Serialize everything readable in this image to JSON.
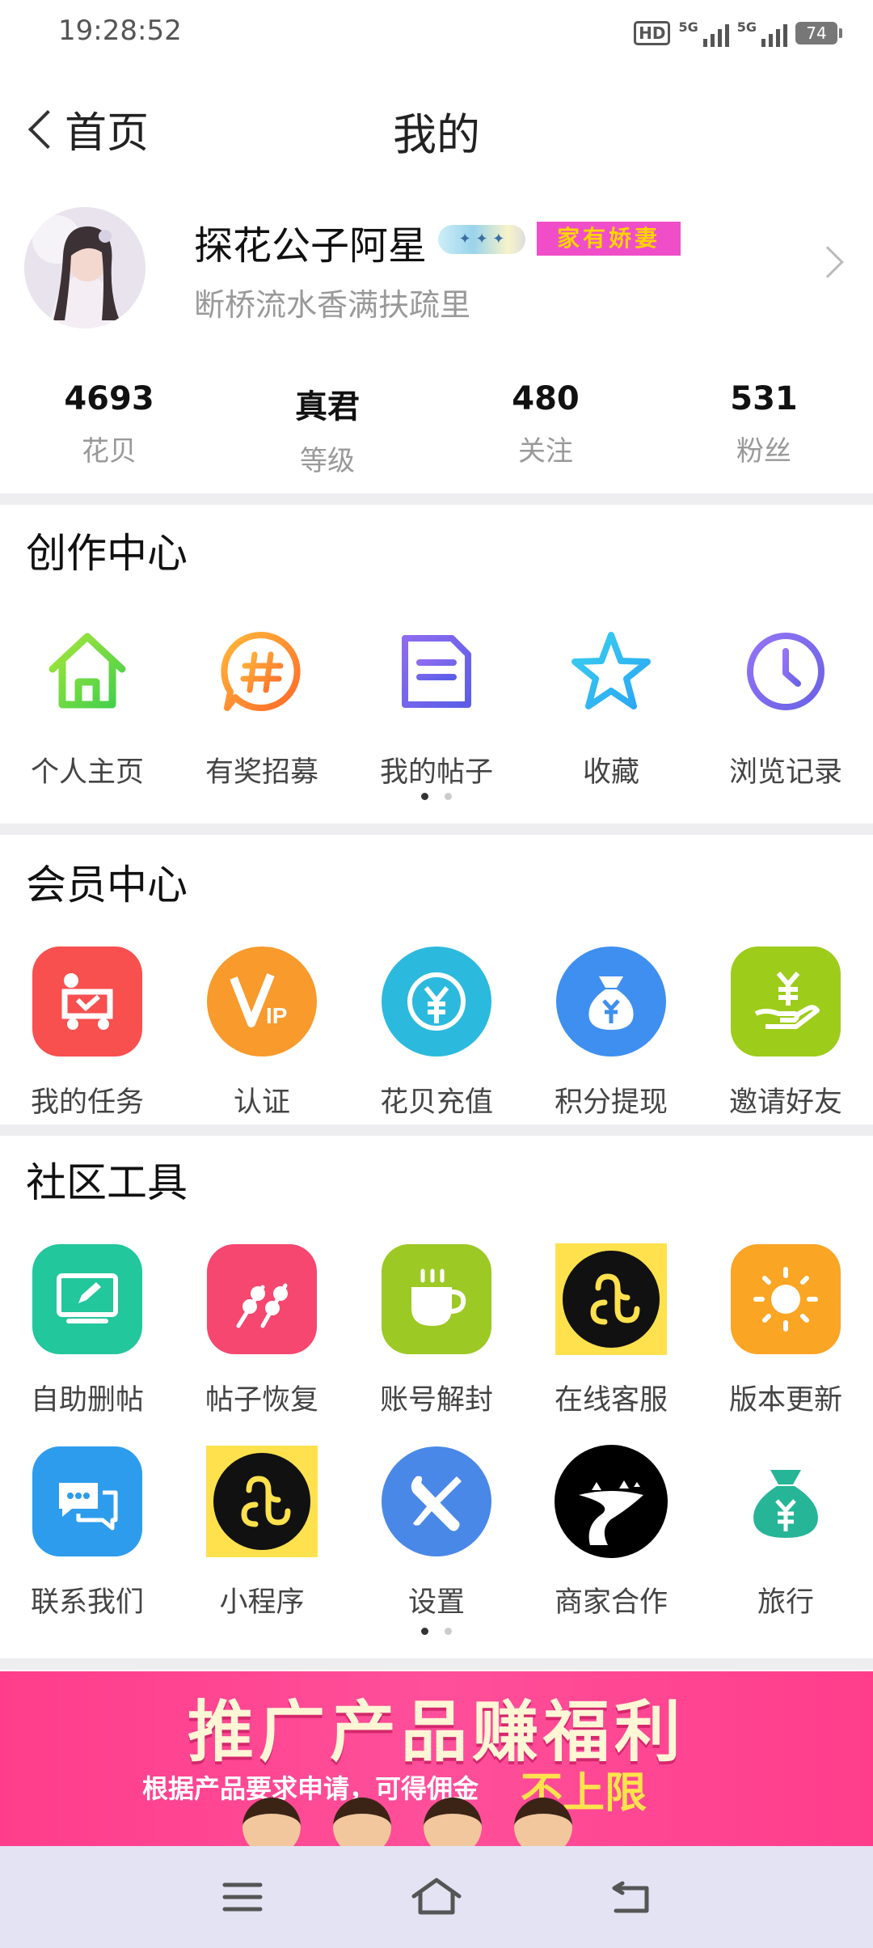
{
  "status_bar": {
    "time": "19:28:52",
    "hd_label": "HD",
    "sim1": "5G",
    "sim2": "5G",
    "battery": "74"
  },
  "nav": {
    "back_label": "首页",
    "title": "我的"
  },
  "profile": {
    "nickname": "探花公子阿星",
    "badge_text": "家有娇妻",
    "signature": "断桥流水香满扶疏里"
  },
  "stats": [
    {
      "value": "4693",
      "label": "花贝"
    },
    {
      "value": "真君",
      "label": "等级"
    },
    {
      "value": "480",
      "label": "关注"
    },
    {
      "value": "531",
      "label": "粉丝"
    }
  ],
  "creation_center": {
    "title": "创作中心",
    "items": [
      {
        "label": "个人主页",
        "icon": "home-icon"
      },
      {
        "label": "有奖招募",
        "icon": "hashtag-icon"
      },
      {
        "label": "我的帖子",
        "icon": "document-icon"
      },
      {
        "label": "收藏",
        "icon": "star-icon"
      },
      {
        "label": "浏览记录",
        "icon": "clock-icon"
      }
    ]
  },
  "member_center": {
    "title": "会员中心",
    "items": [
      {
        "label": "我的任务",
        "icon": "task-icon",
        "color": "#f7504f"
      },
      {
        "label": "认证",
        "icon": "vip-icon",
        "color": "#f89a2c"
      },
      {
        "label": "花贝充值",
        "icon": "yuan-recharge-icon",
        "color": "#2bbadd"
      },
      {
        "label": "积分提现",
        "icon": "money-bag-icon",
        "color": "#3f8ff0"
      },
      {
        "label": "邀请好友",
        "icon": "invite-money-icon",
        "color": "#9dcc1a"
      }
    ]
  },
  "community_tools": {
    "title": "社区工具",
    "row1": [
      {
        "label": "自助删帖",
        "icon": "monitor-edit-icon",
        "color": "#22c79c"
      },
      {
        "label": "帖子恢复",
        "icon": "skewer-icon",
        "color": "#f5476f"
      },
      {
        "label": "账号解封",
        "icon": "coffee-cup-icon",
        "color": "#9cc924"
      },
      {
        "label": "在线客服",
        "icon": "mini-program-icon",
        "color": "#ffe14d"
      },
      {
        "label": "版本更新",
        "icon": "sun-icon",
        "color": "#fba524"
      }
    ],
    "row2": [
      {
        "label": "联系我们",
        "icon": "chat-icon",
        "color": "#2e9cec"
      },
      {
        "label": "小程序",
        "icon": "mini-program-icon",
        "color": "#ffe14d"
      },
      {
        "label": "设置",
        "icon": "wrench-screwdriver-icon",
        "color": "#4a88e8"
      },
      {
        "label": "商家合作",
        "icon": "road-icon",
        "color": "#000000"
      },
      {
        "label": "旅行",
        "icon": "yuan-bag-icon",
        "color": "#26b597"
      }
    ]
  },
  "banner": {
    "title": "推广产品赚福利",
    "subtitle": "根据产品要求申请，可得佣金",
    "highlight": "不上限"
  },
  "system_nav": {
    "menu": "menu-icon",
    "home": "home-outline-icon",
    "back": "back-icon"
  }
}
